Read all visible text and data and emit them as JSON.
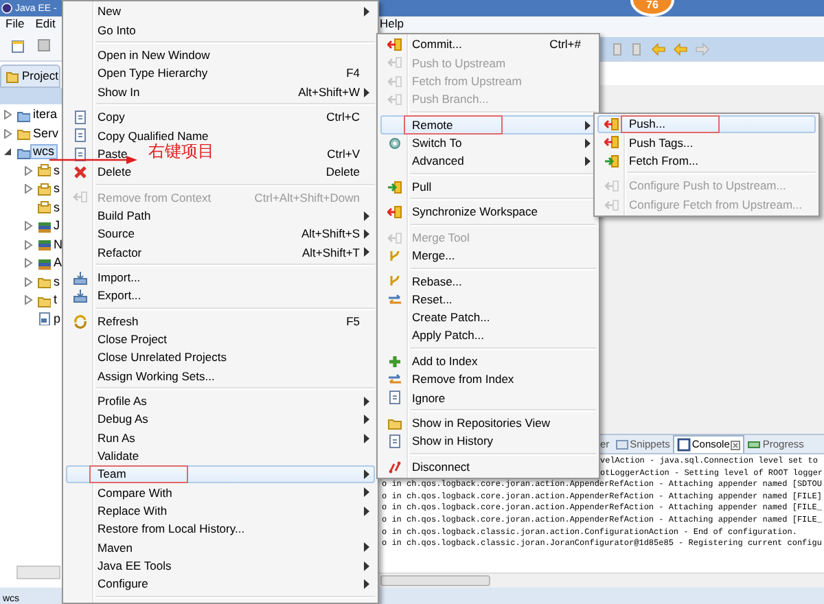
{
  "window": {
    "title": "Java EE -"
  },
  "badge": "76",
  "menu_bar": [
    {
      "label": "File",
      "kind": "left"
    },
    {
      "label": "Edit",
      "kind": "left"
    },
    {
      "label": "Help",
      "kind": "right"
    }
  ],
  "project_explorer": {
    "tab": "Project",
    "tree": [
      {
        "label": "itera",
        "kind": "project",
        "has_children": true,
        "expanded": false,
        "selected": false
      },
      {
        "label": "Serv",
        "kind": "folder",
        "has_children": true,
        "expanded": false,
        "selected": false
      },
      {
        "label": "wcs",
        "kind": "project",
        "has_children": true,
        "expanded": true,
        "selected": true,
        "children": [
          {
            "label": "s",
            "kind": "package",
            "has_children": true,
            "expanded": false,
            "selected": false
          },
          {
            "label": "s",
            "kind": "package",
            "has_children": true,
            "expanded": false,
            "selected": false
          },
          {
            "label": "s",
            "kind": "package",
            "has_children": false,
            "expanded": false,
            "selected": false
          },
          {
            "label": "J",
            "kind": "library",
            "has_children": true,
            "expanded": false,
            "selected": false
          },
          {
            "label": "N",
            "kind": "library",
            "has_children": true,
            "expanded": false,
            "selected": false
          },
          {
            "label": "A",
            "kind": "library",
            "has_children": true,
            "expanded": false,
            "selected": false
          },
          {
            "label": "s",
            "kind": "folder",
            "has_children": true,
            "expanded": false,
            "selected": false
          },
          {
            "label": "t",
            "kind": "folder",
            "has_children": true,
            "expanded": false,
            "selected": false
          },
          {
            "label": "p",
            "kind": "file",
            "has_children": false,
            "expanded": false,
            "selected": false
          }
        ]
      }
    ]
  },
  "console": {
    "tabs": [
      {
        "label": "er",
        "selected": false
      },
      {
        "label": "Snippets",
        "selected": false
      },
      {
        "label": "Console",
        "selected": true
      },
      {
        "label": "Progress",
        "selected": false
      }
    ],
    "lines": [
      {
        "text": "velAction - java.sql.Connection level set to",
        "partly_hidden": true
      },
      {
        "text": "otLoggerAction - Setting level of ROOT logger",
        "partly_hidden": true
      },
      {
        "text": "o in ch.qos.logback.core.joran.action.AppenderRefAction - Attaching appender named [SDTOU",
        "partly_hidden": false
      },
      {
        "text": "o in ch.qos.logback.core.joran.action.AppenderRefAction - Attaching appender named [FILE]",
        "partly_hidden": false
      },
      {
        "text": "o in ch.qos.logback.core.joran.action.AppenderRefAction - Attaching appender named [FILE_",
        "partly_hidden": false
      },
      {
        "text": "o in ch.qos.logback.core.joran.action.AppenderRefAction - Attaching appender named [FILE_",
        "partly_hidden": false
      },
      {
        "text": "o in ch.qos.logback.classic.joran.action.ConfigurationAction - End of configuration.",
        "partly_hidden": false
      },
      {
        "text": "o in ch.qos.logback.classic.joran.JoranConfigurator@1d85e85 - Registering current configu",
        "partly_hidden": false
      }
    ]
  },
  "status_bar": "wcs",
  "annotation": {
    "text": "右键项目"
  },
  "context_menu": {
    "items": [
      {
        "kind": "item",
        "label": "New",
        "submenu": true,
        "disabled": false,
        "selected": false,
        "annotated": false
      },
      {
        "kind": "item",
        "label": "Go Into",
        "submenu": false,
        "disabled": false,
        "selected": false,
        "annotated": false
      },
      {
        "kind": "separator"
      },
      {
        "kind": "item",
        "label": "Open in New Window",
        "submenu": false,
        "disabled": false,
        "selected": false,
        "annotated": false
      },
      {
        "kind": "item",
        "label": "Open Type Hierarchy",
        "shortcut": "F4",
        "submenu": false,
        "disabled": false,
        "selected": false,
        "annotated": false
      },
      {
        "kind": "item",
        "label": "Show In",
        "shortcut": "Alt+Shift+W",
        "submenu": true,
        "disabled": false,
        "selected": false,
        "annotated": false
      },
      {
        "kind": "separator"
      },
      {
        "kind": "item",
        "label": "Copy",
        "shortcut": "Ctrl+C",
        "submenu": false,
        "disabled": false,
        "selected": false,
        "annotated": false
      },
      {
        "kind": "item",
        "label": "Copy Qualified Name",
        "submenu": false,
        "disabled": false,
        "selected": false,
        "annotated": false
      },
      {
        "kind": "item",
        "label": "Paste",
        "shortcut": "Ctrl+V",
        "submenu": false,
        "disabled": false,
        "selected": false,
        "annotated": false
      },
      {
        "kind": "item",
        "label": "Delete",
        "shortcut": "Delete",
        "submenu": false,
        "disabled": false,
        "selected": false,
        "annotated": false
      },
      {
        "kind": "separator"
      },
      {
        "kind": "item",
        "label": "Remove from Context",
        "shortcut": "Ctrl+Alt+Shift+Down",
        "submenu": false,
        "disabled": true,
        "selected": false,
        "annotated": false
      },
      {
        "kind": "item",
        "label": "Build Path",
        "submenu": true,
        "disabled": false,
        "selected": false,
        "annotated": false
      },
      {
        "kind": "item",
        "label": "Source",
        "shortcut": "Alt+Shift+S",
        "submenu": true,
        "disabled": false,
        "selected": false,
        "annotated": false
      },
      {
        "kind": "item",
        "label": "Refactor",
        "shortcut": "Alt+Shift+T",
        "submenu": true,
        "disabled": false,
        "selected": false,
        "annotated": false
      },
      {
        "kind": "separator"
      },
      {
        "kind": "item",
        "label": "Import...",
        "submenu": false,
        "disabled": false,
        "selected": false,
        "annotated": false
      },
      {
        "kind": "item",
        "label": "Export...",
        "submenu": false,
        "disabled": false,
        "selected": false,
        "annotated": false
      },
      {
        "kind": "separator"
      },
      {
        "kind": "item",
        "label": "Refresh",
        "shortcut": "F5",
        "submenu": false,
        "disabled": false,
        "selected": false,
        "annotated": false
      },
      {
        "kind": "item",
        "label": "Close Project",
        "submenu": false,
        "disabled": false,
        "selected": false,
        "annotated": false
      },
      {
        "kind": "item",
        "label": "Close Unrelated Projects",
        "submenu": false,
        "disabled": false,
        "selected": false,
        "annotated": false
      },
      {
        "kind": "item",
        "label": "Assign Working Sets...",
        "submenu": false,
        "disabled": false,
        "selected": false,
        "annotated": false
      },
      {
        "kind": "separator"
      },
      {
        "kind": "item",
        "label": "Profile As",
        "submenu": true,
        "disabled": false,
        "selected": false,
        "annotated": false
      },
      {
        "kind": "item",
        "label": "Debug As",
        "submenu": true,
        "disabled": false,
        "selected": false,
        "annotated": false
      },
      {
        "kind": "item",
        "label": "Run As",
        "submenu": true,
        "disabled": false,
        "selected": false,
        "annotated": false
      },
      {
        "kind": "item",
        "label": "Validate",
        "submenu": false,
        "disabled": false,
        "selected": false,
        "annotated": false
      },
      {
        "kind": "item",
        "label": "Team",
        "submenu": true,
        "disabled": false,
        "selected": true,
        "annotated": true
      },
      {
        "kind": "item",
        "label": "Compare With",
        "submenu": true,
        "disabled": false,
        "selected": false,
        "annotated": false
      },
      {
        "kind": "item",
        "label": "Replace With",
        "submenu": true,
        "disabled": false,
        "selected": false,
        "annotated": false
      },
      {
        "kind": "item",
        "label": "Restore from Local History...",
        "submenu": false,
        "disabled": false,
        "selected": false,
        "annotated": false
      },
      {
        "kind": "item",
        "label": "Maven",
        "submenu": true,
        "disabled": false,
        "selected": false,
        "annotated": false
      },
      {
        "kind": "item",
        "label": "Java EE Tools",
        "submenu": true,
        "disabled": false,
        "selected": false,
        "annotated": false
      },
      {
        "kind": "item",
        "label": "Configure",
        "submenu": true,
        "disabled": false,
        "selected": false,
        "annotated": false
      },
      {
        "kind": "separator"
      }
    ]
  },
  "team_menu": {
    "items": [
      {
        "kind": "item",
        "label": "Commit...",
        "shortcut": "Ctrl+#",
        "submenu": false,
        "disabled": false,
        "selected": false,
        "annotated": false
      },
      {
        "kind": "item",
        "label": "Push to Upstream",
        "submenu": false,
        "disabled": true,
        "selected": false,
        "annotated": false
      },
      {
        "kind": "item",
        "label": "Fetch from Upstream",
        "submenu": false,
        "disabled": true,
        "selected": false,
        "annotated": false
      },
      {
        "kind": "item",
        "label": "Push Branch...",
        "submenu": false,
        "disabled": true,
        "selected": false,
        "annotated": false
      },
      {
        "kind": "separator"
      },
      {
        "kind": "item",
        "label": "Remote",
        "submenu": true,
        "disabled": false,
        "selected": true,
        "annotated": true
      },
      {
        "kind": "item",
        "label": "Switch To",
        "submenu": true,
        "disabled": false,
        "selected": false,
        "annotated": false
      },
      {
        "kind": "item",
        "label": "Advanced",
        "submenu": true,
        "disabled": false,
        "selected": false,
        "annotated": false
      },
      {
        "kind": "separator"
      },
      {
        "kind": "item",
        "label": "Pull",
        "submenu": false,
        "disabled": false,
        "selected": false,
        "annotated": false
      },
      {
        "kind": "separator"
      },
      {
        "kind": "item",
        "label": "Synchronize Workspace",
        "submenu": false,
        "disabled": false,
        "selected": false,
        "annotated": false
      },
      {
        "kind": "separator"
      },
      {
        "kind": "item",
        "label": "Merge Tool",
        "submenu": false,
        "disabled": true,
        "selected": false,
        "annotated": false
      },
      {
        "kind": "item",
        "label": "Merge...",
        "submenu": false,
        "disabled": false,
        "selected": false,
        "annotated": false
      },
      {
        "kind": "separator"
      },
      {
        "kind": "item",
        "label": "Rebase...",
        "submenu": false,
        "disabled": false,
        "selected": false,
        "annotated": false
      },
      {
        "kind": "item",
        "label": "Reset...",
        "submenu": false,
        "disabled": false,
        "selected": false,
        "annotated": false
      },
      {
        "kind": "item",
        "label": "Create Patch...",
        "submenu": false,
        "disabled": false,
        "selected": false,
        "annotated": false
      },
      {
        "kind": "item",
        "label": "Apply Patch...",
        "submenu": false,
        "disabled": false,
        "selected": false,
        "annotated": false
      },
      {
        "kind": "separator"
      },
      {
        "kind": "item",
        "label": "Add to Index",
        "submenu": false,
        "disabled": false,
        "selected": false,
        "annotated": false
      },
      {
        "kind": "item",
        "label": "Remove from Index",
        "submenu": false,
        "disabled": false,
        "selected": false,
        "annotated": false
      },
      {
        "kind": "item",
        "label": "Ignore",
        "submenu": false,
        "disabled": false,
        "selected": false,
        "annotated": false
      },
      {
        "kind": "separator"
      },
      {
        "kind": "item",
        "label": "Show in Repositories View",
        "submenu": false,
        "disabled": false,
        "selected": false,
        "annotated": false
      },
      {
        "kind": "item",
        "label": "Show in History",
        "submenu": false,
        "disabled": false,
        "selected": false,
        "annotated": false
      },
      {
        "kind": "separator"
      },
      {
        "kind": "item",
        "label": "Disconnect",
        "submenu": false,
        "disabled": false,
        "selected": false,
        "annotated": false
      }
    ]
  },
  "remote_menu": {
    "items": [
      {
        "kind": "item",
        "label": "Push...",
        "submenu": false,
        "disabled": false,
        "selected": true,
        "annotated": true
      },
      {
        "kind": "item",
        "label": "Push Tags...",
        "submenu": false,
        "disabled": false,
        "selected": false,
        "annotated": false
      },
      {
        "kind": "item",
        "label": "Fetch From...",
        "submenu": false,
        "disabled": false,
        "selected": false,
        "annotated": false
      },
      {
        "kind": "separator"
      },
      {
        "kind": "item",
        "label": "Configure Push to Upstream...",
        "submenu": false,
        "disabled": true,
        "selected": false,
        "annotated": false
      },
      {
        "kind": "item",
        "label": "Configure Fetch from Upstream...",
        "submenu": false,
        "disabled": true,
        "selected": false,
        "annotated": false
      }
    ]
  }
}
